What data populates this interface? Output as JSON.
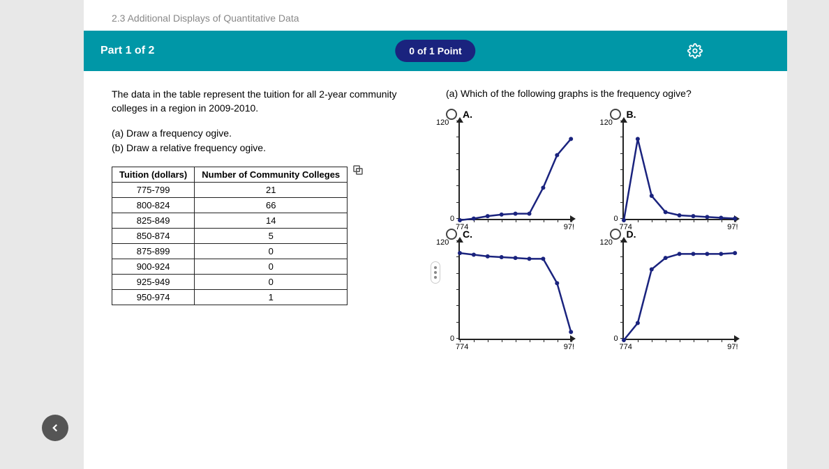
{
  "section_title": "2.3 Additional Displays of Quantitative Data",
  "banner": {
    "part": "Part 1 of 2",
    "points": "0 of 1 Point"
  },
  "left": {
    "intro": "The data in the table represent the tuition for all 2-year community colleges in a region in 2009-2010.",
    "sub_a": "(a) Draw a frequency ogive.",
    "sub_b": "(b) Draw a relative frequency ogive.",
    "table": {
      "col1": "Tuition (dollars)",
      "col2": "Number of Community Colleges",
      "rows": [
        {
          "range": "775-799",
          "count": "21"
        },
        {
          "range": "800-824",
          "count": "66"
        },
        {
          "range": "825-849",
          "count": "14"
        },
        {
          "range": "850-874",
          "count": "5"
        },
        {
          "range": "875-899",
          "count": "0"
        },
        {
          "range": "900-924",
          "count": "0"
        },
        {
          "range": "925-949",
          "count": "0"
        },
        {
          "range": "950-974",
          "count": "1"
        }
      ]
    }
  },
  "right": {
    "question": "(a) Which of the following graphs is the frequency ogive?",
    "labels": {
      "A": "A.",
      "B": "B.",
      "C": "C.",
      "D": "D."
    },
    "axis": {
      "ymax": "120",
      "ymin": "0",
      "xmin": "774",
      "xmax": "97!"
    }
  },
  "chart_data": [
    {
      "type": "line",
      "option": "A",
      "x": [
        774,
        799,
        824,
        849,
        874,
        899,
        924,
        949,
        974
      ],
      "values": [
        0,
        2,
        5,
        7,
        8,
        8,
        40,
        80,
        100
      ],
      "ylim": [
        0,
        120
      ],
      "xlim": [
        774,
        975
      ],
      "points": true
    },
    {
      "type": "line",
      "option": "B",
      "x": [
        774,
        799,
        824,
        849,
        874,
        899,
        924,
        949,
        974
      ],
      "values": [
        0,
        100,
        30,
        10,
        6,
        5,
        4,
        3,
        2
      ],
      "ylim": [
        0,
        120
      ],
      "xlim": [
        774,
        975
      ],
      "points": true
    },
    {
      "type": "line",
      "option": "C",
      "x": [
        774,
        799,
        824,
        849,
        874,
        899,
        924,
        949,
        974
      ],
      "values": [
        107,
        105,
        103,
        102,
        101,
        100,
        100,
        70,
        10
      ],
      "ylim": [
        0,
        120
      ],
      "xlim": [
        774,
        975
      ],
      "points": true
    },
    {
      "type": "line",
      "option": "D",
      "x": [
        774,
        799,
        824,
        849,
        874,
        899,
        924,
        949,
        974
      ],
      "values": [
        0,
        21,
        87,
        101,
        106,
        106,
        106,
        106,
        107
      ],
      "ylim": [
        0,
        120
      ],
      "xlim": [
        774,
        975
      ],
      "points": true
    }
  ]
}
